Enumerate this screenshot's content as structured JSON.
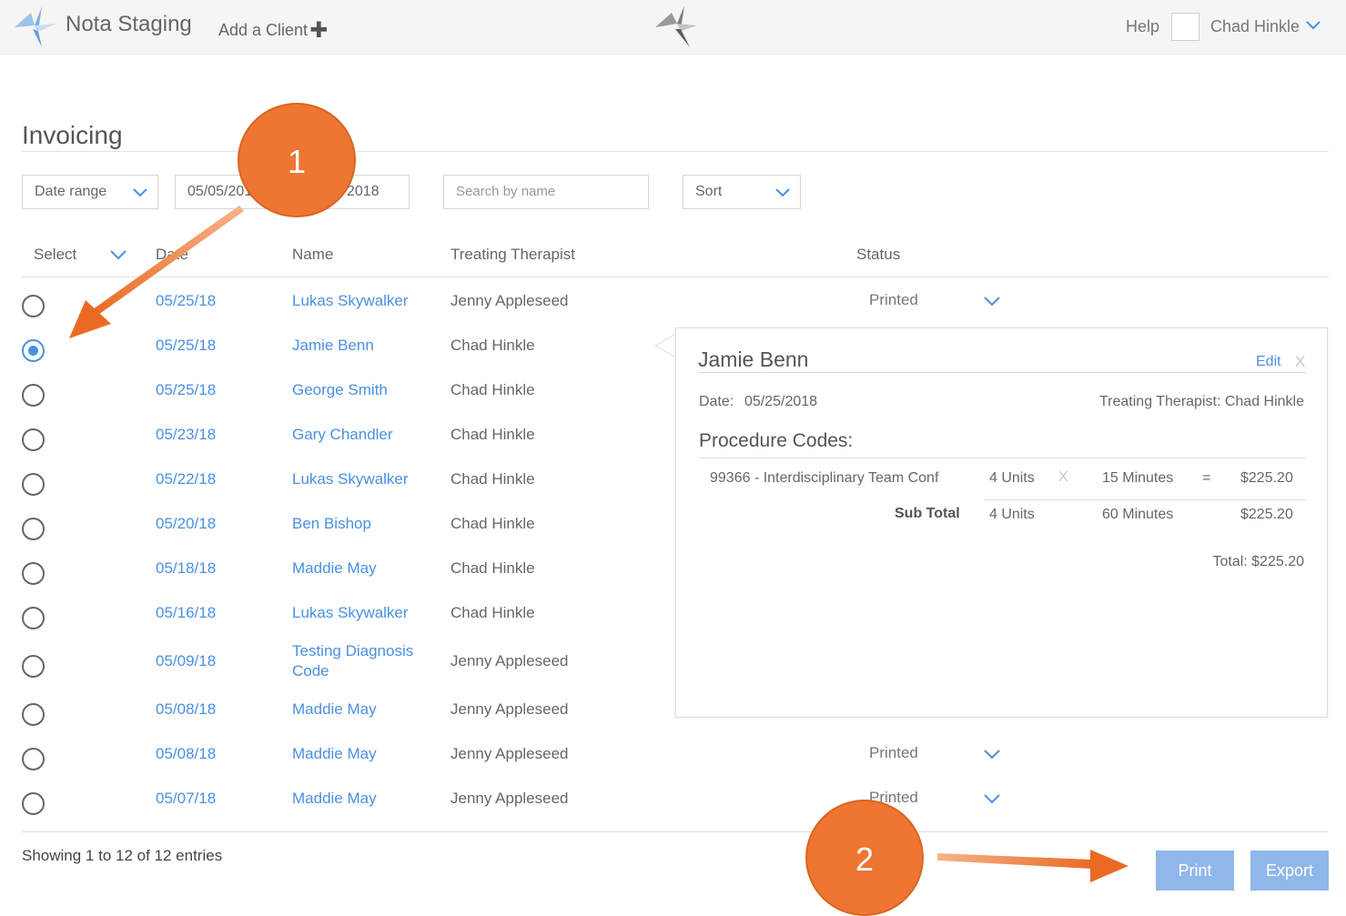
{
  "header": {
    "app_title": "Nota Staging",
    "add_client_label": "Add a Client",
    "help_label": "Help",
    "user_name": "Chad Hinkle"
  },
  "page": {
    "title": "Invoicing"
  },
  "filters": {
    "date_range_label": "Date range",
    "date_from": "05/05/201",
    "date_to": "2018",
    "search_placeholder": "Search by name",
    "sort_label": "Sort"
  },
  "table": {
    "headers": {
      "select": "Select",
      "date": "Date",
      "name": "Name",
      "therapist": "Treating Therapist",
      "status": "Status"
    },
    "rows": [
      {
        "date": "05/25/18",
        "name": "Lukas Skywalker",
        "therapist": "Jenny Appleseed",
        "status": "Printed",
        "selected": false
      },
      {
        "date": "05/25/18",
        "name": "Jamie Benn",
        "therapist": "Chad Hinkle",
        "status": "",
        "selected": true
      },
      {
        "date": "05/25/18",
        "name": "George Smith",
        "therapist": "Chad Hinkle",
        "status": "",
        "selected": false
      },
      {
        "date": "05/23/18",
        "name": "Gary Chandler",
        "therapist": "Chad Hinkle",
        "status": "",
        "selected": false
      },
      {
        "date": "05/22/18",
        "name": "Lukas Skywalker",
        "therapist": "Chad Hinkle",
        "status": "",
        "selected": false
      },
      {
        "date": "05/20/18",
        "name": "Ben Bishop",
        "therapist": "Chad Hinkle",
        "status": "",
        "selected": false
      },
      {
        "date": "05/18/18",
        "name": "Maddie May",
        "therapist": "Chad Hinkle",
        "status": "",
        "selected": false
      },
      {
        "date": "05/16/18",
        "name": "Lukas Skywalker",
        "therapist": "Chad Hinkle",
        "status": "",
        "selected": false
      },
      {
        "date": "05/09/18",
        "name": "Testing Diagnosis Code",
        "therapist": "Jenny Appleseed",
        "status": "",
        "selected": false
      },
      {
        "date": "05/08/18",
        "name": "Maddie May",
        "therapist": "Jenny Appleseed",
        "status": "",
        "selected": false
      },
      {
        "date": "05/08/18",
        "name": "Maddie May",
        "therapist": "Jenny Appleseed",
        "status": "Printed",
        "selected": false
      },
      {
        "date": "05/07/18",
        "name": "Maddie May",
        "therapist": "Jenny Appleseed",
        "status": "Printed",
        "selected": false
      }
    ],
    "showing_text": "Showing 1 to 12 of 12 entries"
  },
  "detail": {
    "patient_name": "Jamie Benn",
    "edit_label": "Edit",
    "close_label": "X",
    "date_label": "Date:",
    "date_value": "05/25/2018",
    "therapist_text": "Treating Therapist: Chad Hinkle",
    "procedure_heading": "Procedure Codes:",
    "procedure": {
      "code": "99366 - Interdisciplinary Team Conf",
      "units": "4 Units",
      "times": "X",
      "minutes": "15 Minutes",
      "equals": "=",
      "amount": "$225.20"
    },
    "subtotal": {
      "label": "Sub Total",
      "units": "4 Units",
      "minutes": "60 Minutes",
      "amount": "$225.20"
    },
    "total_text": "Total: $225.20"
  },
  "actions": {
    "print_label": "Print",
    "export_label": "Export"
  },
  "annotations": {
    "step_1": "1",
    "step_2": "2"
  },
  "colors": {
    "accent": "#4a90e2",
    "button": "#8fb7ea",
    "annotation": "#ee7532"
  },
  "icons": {
    "logo": "bird-logo-icon",
    "chevron": "chevron-down-icon",
    "plus": "plus-icon"
  }
}
